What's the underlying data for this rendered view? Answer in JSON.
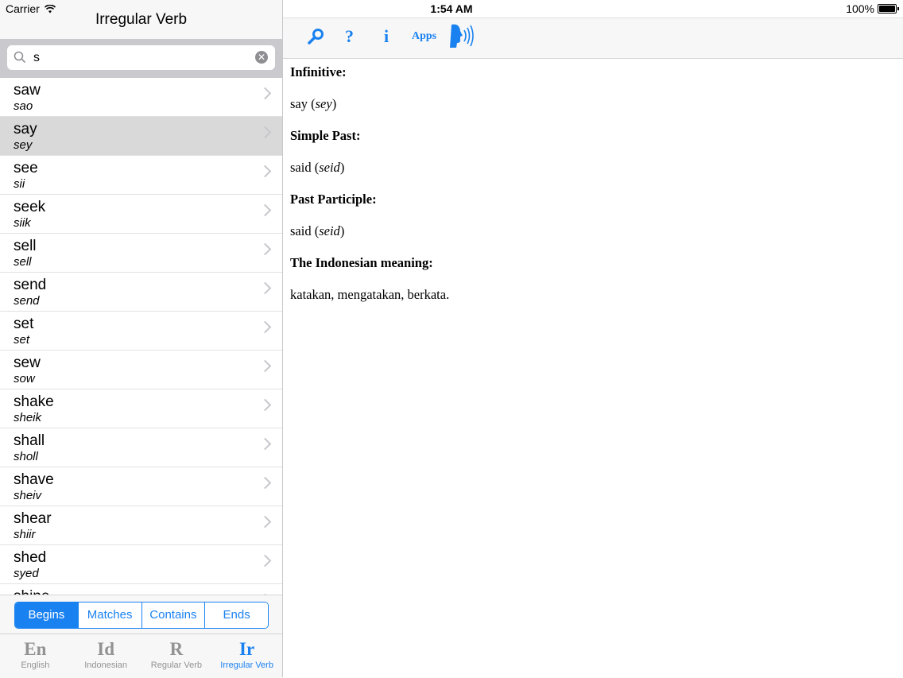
{
  "status": {
    "carrier": "Carrier",
    "time": "1:54 AM",
    "battery": "100%"
  },
  "master": {
    "title": "Irregular Verb",
    "search": {
      "value": "s"
    },
    "rows": [
      {
        "word": "saw",
        "pron": "sao"
      },
      {
        "word": "say",
        "pron": "sey"
      },
      {
        "word": "see",
        "pron": "sii"
      },
      {
        "word": "seek",
        "pron": "siik"
      },
      {
        "word": "sell",
        "pron": "sell"
      },
      {
        "word": "send",
        "pron": "send"
      },
      {
        "word": "set",
        "pron": "set"
      },
      {
        "word": "sew",
        "pron": "sow"
      },
      {
        "word": "shake",
        "pron": "sheik"
      },
      {
        "word": "shall",
        "pron": "sholl"
      },
      {
        "word": "shave",
        "pron": "sheiv"
      },
      {
        "word": "shear",
        "pron": "shiir"
      },
      {
        "word": "shed",
        "pron": "syed"
      },
      {
        "word": "shine",
        "pron": ""
      }
    ],
    "selected_row": "say",
    "segments": [
      "Begins",
      "Matches",
      "Contains",
      "Ends"
    ],
    "active_segment": "Begins",
    "tabs": [
      {
        "glyph": "En",
        "label": "English"
      },
      {
        "glyph": "Id",
        "label": "Indonesian"
      },
      {
        "glyph": "R",
        "label": "Regular Verb"
      },
      {
        "glyph": "Ir",
        "label": "Irregular Verb"
      }
    ],
    "active_tab": "Irregular Verb"
  },
  "detail": {
    "toolbar": {
      "help": "?",
      "info": "i",
      "apps": "Apps"
    },
    "infinitive_label": "Infinitive:",
    "infinitive_word": "say",
    "infinitive_pron": "sey",
    "simple_past_label": "Simple Past:",
    "simple_past_word": "said",
    "simple_past_pron": "seid",
    "past_participle_label": "Past Participle:",
    "past_participle_word": "said",
    "past_participle_pron": "seid",
    "meaning_label": "The Indonesian meaning:",
    "meaning_text": "katakan, mengatakan, berkata."
  },
  "colors": {
    "accent": "#1a82f0",
    "selected_row": "#d9d9d9"
  }
}
